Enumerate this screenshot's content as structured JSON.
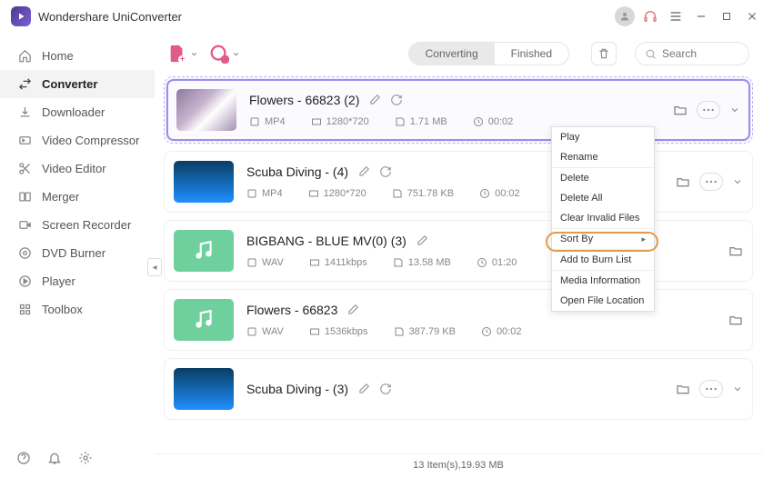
{
  "app": {
    "title": "Wondershare UniConverter"
  },
  "sidebar": {
    "items": [
      {
        "label": "Home"
      },
      {
        "label": "Converter"
      },
      {
        "label": "Downloader"
      },
      {
        "label": "Video Compressor"
      },
      {
        "label": "Video Editor"
      },
      {
        "label": "Merger"
      },
      {
        "label": "Screen Recorder"
      },
      {
        "label": "DVD Burner"
      },
      {
        "label": "Player"
      },
      {
        "label": "Toolbox"
      }
    ]
  },
  "toolbar": {
    "tab_converting": "Converting",
    "tab_finished": "Finished",
    "search_placeholder": "Search"
  },
  "files": [
    {
      "title": "Flowers - 66823 (2)",
      "fmt": "MP4",
      "res": "1280*720",
      "size": "1.71 MB",
      "dur": "00:02"
    },
    {
      "title": "Scuba Diving - (4)",
      "fmt": "MP4",
      "res": "1280*720",
      "size": "751.78 KB",
      "dur": "00:02"
    },
    {
      "title": "BIGBANG - BLUE MV(0) (3)",
      "fmt": "WAV",
      "res": "1411kbps",
      "size": "13.58 MB",
      "dur": "01:20"
    },
    {
      "title": "Flowers - 66823",
      "fmt": "WAV",
      "res": "1536kbps",
      "size": "387.79 KB",
      "dur": "00:02"
    },
    {
      "title": "Scuba Diving - (3)",
      "fmt": "",
      "res": "",
      "size": "",
      "dur": ""
    }
  ],
  "context_menu": {
    "items": [
      {
        "label": "Play"
      },
      {
        "label": "Rename"
      },
      {
        "label": "Delete",
        "sep": true
      },
      {
        "label": "Delete All"
      },
      {
        "label": "Clear Invalid Files"
      },
      {
        "label": "Sort By",
        "sep": true,
        "arrow": true
      },
      {
        "label": "Add to Burn List",
        "sep": true,
        "highlight": true
      },
      {
        "label": "Media Information",
        "sep": true
      },
      {
        "label": "Open File Location"
      }
    ]
  },
  "footer": {
    "status": "13 Item(s),19.93 MB"
  }
}
